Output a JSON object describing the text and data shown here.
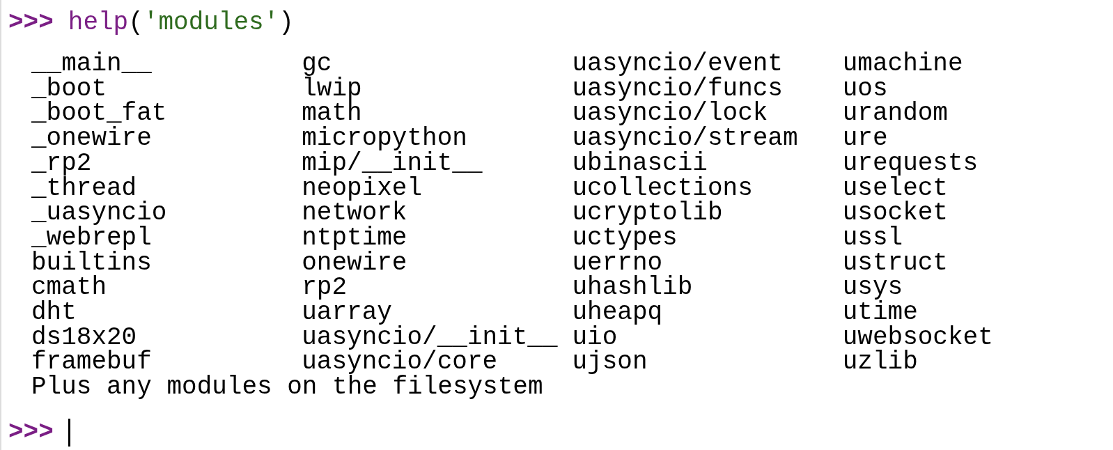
{
  "input_line": [
    {
      "kind": "prompt",
      "text": ">>>"
    },
    {
      "kind": "function",
      "text": "help"
    },
    {
      "kind": "punct",
      "text": "("
    },
    {
      "kind": "string",
      "text": "'modules'"
    },
    {
      "kind": "punct",
      "text": ")"
    }
  ],
  "module_columns": [
    [
      "__main__",
      "_boot",
      "_boot_fat",
      "_onewire",
      "_rp2",
      "_thread",
      "_uasyncio",
      "_webrepl",
      "builtins",
      "cmath",
      "dht",
      "ds18x20",
      "framebuf"
    ],
    [
      "gc",
      "lwip",
      "math",
      "micropython",
      "mip/__init__",
      "neopixel",
      "network",
      "ntptime",
      "onewire",
      "rp2",
      "uarray",
      "uasyncio/__init__",
      "uasyncio/core"
    ],
    [
      "uasyncio/event",
      "uasyncio/funcs",
      "uasyncio/lock",
      "uasyncio/stream",
      "ubinascii",
      "ucollections",
      "ucryptolib",
      "uctypes",
      "uerrno",
      "uhashlib",
      "uheapq",
      "uio",
      "ujson"
    ],
    [
      "umachine",
      "uos",
      "urandom",
      "ure",
      "urequests",
      "uselect",
      "usocket",
      "ussl",
      "ustruct",
      "usys",
      "utime",
      "uwebsocket",
      "uzlib"
    ]
  ],
  "footer_note": "Plus any modules on the filesystem",
  "final_prompt": ">>>"
}
